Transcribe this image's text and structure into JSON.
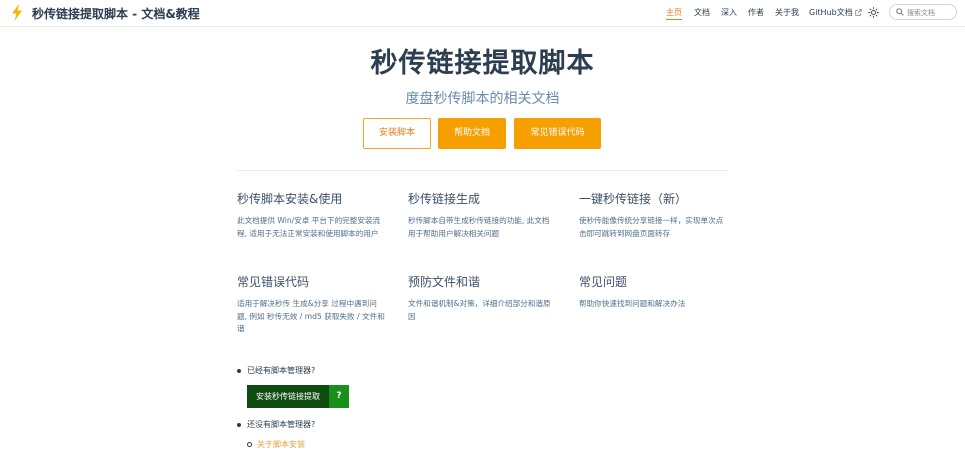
{
  "header": {
    "title": "秒传链接提取脚本 - 文档&教程",
    "nav": [
      {
        "label": "主页",
        "active": true
      },
      {
        "label": "文档",
        "active": false
      },
      {
        "label": "深入",
        "active": false
      },
      {
        "label": "作者",
        "active": false
      },
      {
        "label": "关于我",
        "active": false
      },
      {
        "label": "GitHub文档",
        "active": false,
        "external": true
      }
    ],
    "search_placeholder": "搜索文档",
    "theme_icon": "sun-icon",
    "logo_icon": "lightning-icon",
    "accent_color": "#f5a000"
  },
  "hero": {
    "title": "秒传链接提取脚本",
    "subtitle": "度盘秒传脚本的相关文档",
    "buttons": [
      {
        "label": "安装脚本",
        "style": "outline"
      },
      {
        "label": "帮助文档",
        "style": "primary"
      },
      {
        "label": "常见错误代码",
        "style": "primary"
      }
    ]
  },
  "features": [
    {
      "title": "秒传脚本安装&使用",
      "desc": "此文档提供 Win/安卓 平台下的完整安装流程, 适用于无法正常安装和使用脚本的用户"
    },
    {
      "title": "秒传链接生成",
      "desc": "秒传脚本自带生成秒传链接的功能, 此文档用于帮助用户解决相关问题"
    },
    {
      "title": "一键秒传链接（新）",
      "desc": "使秒传能像传统分享链接一样，实现单次点击即可跳转到网盘页面转存"
    },
    {
      "title": "常见错误代码",
      "desc": "适用于解决秒传 生成&分享 过程中遇到问题, 例如 秒传无效 / md5 获取失败 / 文件和谐"
    },
    {
      "title": "预防文件和谐",
      "desc": "文件和谐机制&对策，详细介绍部分和谐原因"
    },
    {
      "title": "常见问题",
      "desc": "帮助你快速找到问题和解决办法"
    }
  ],
  "bottom": {
    "item1": "已经有脚本管理器?",
    "install_button": "安装秒传链接提取",
    "help_button": "?",
    "item2": "还没有脚本管理器?",
    "sublink": "关于脚本安装"
  }
}
